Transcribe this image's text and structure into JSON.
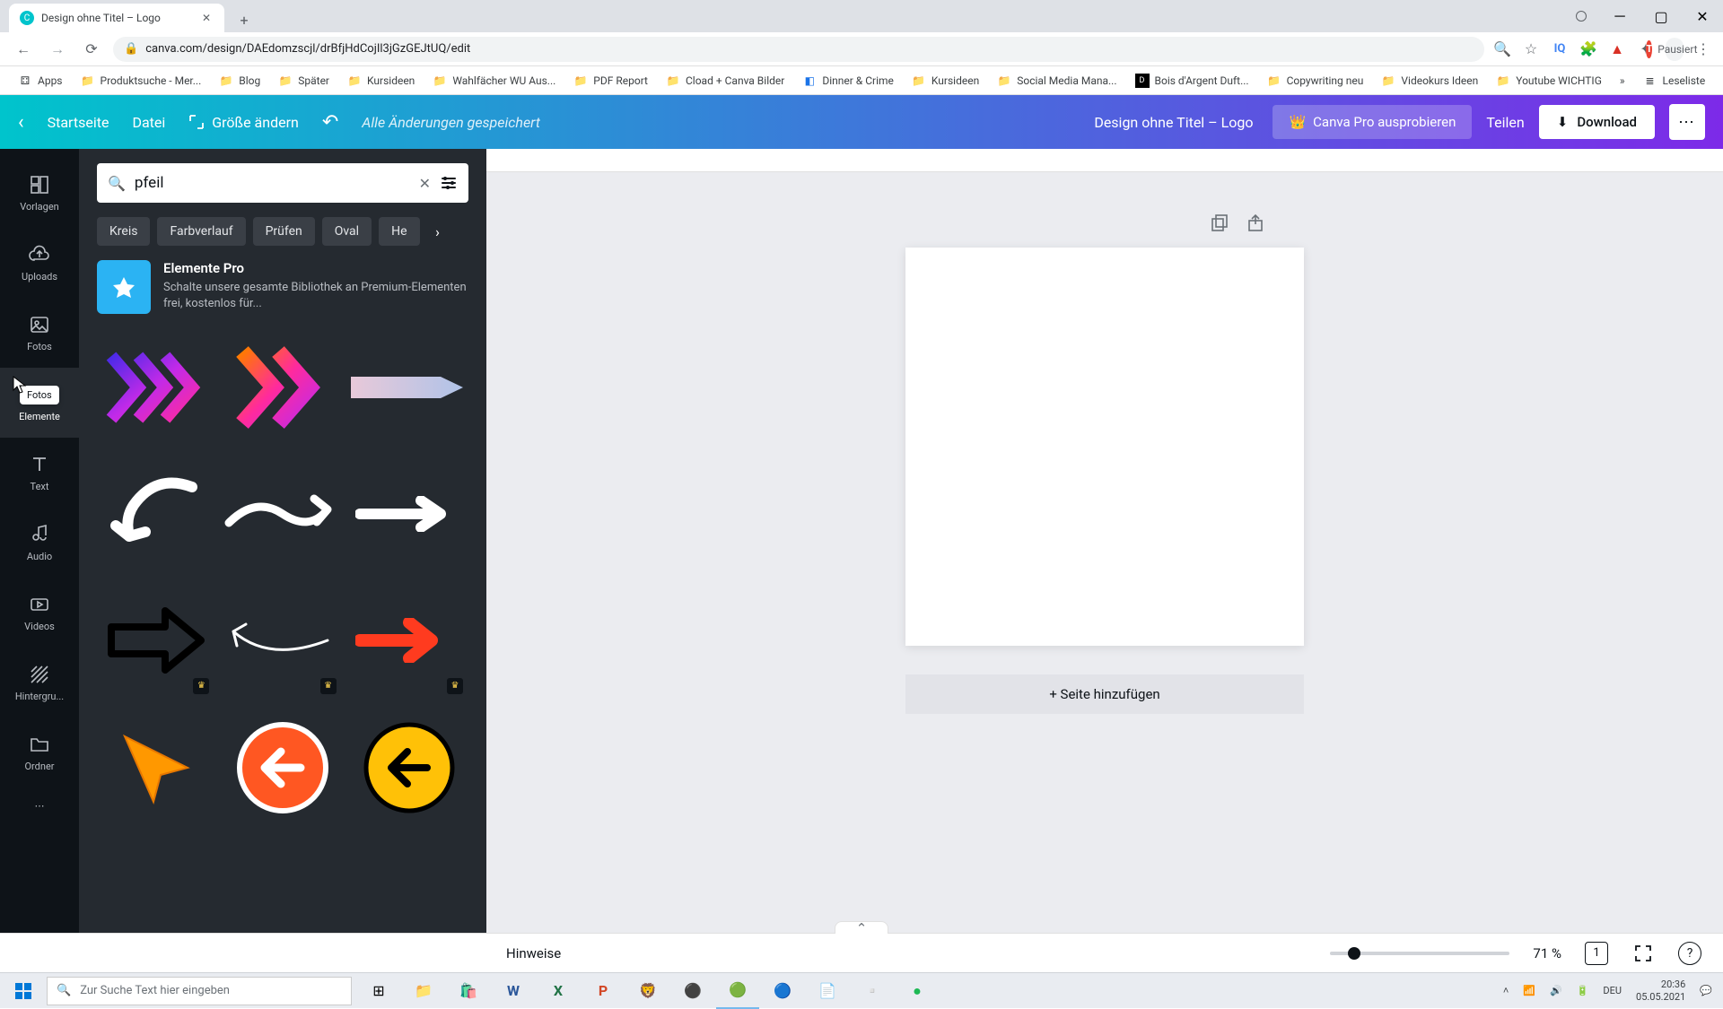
{
  "browser": {
    "tab_title": "Design ohne Titel – Logo",
    "url": "canva.com/design/DAEdomzscjl/drBfjHdCojIl3jGzGEJtUQ/edit",
    "profile_state": "Pausiert",
    "profile_initial": "T",
    "bookmarks": [
      "Apps",
      "Produktsuche - Mer...",
      "Blog",
      "Später",
      "Kursideen",
      "Wahlfächer WU Aus...",
      "PDF Report",
      "Cload + Canva Bilder",
      "Dinner & Crime",
      "Kursideen",
      "Social Media Mana...",
      "Bois d'Argent Duft...",
      "Copywriting neu",
      "Videokurs Ideen",
      "Youtube WICHTIG",
      "Leseliste"
    ]
  },
  "canva_top": {
    "back": "Startseite",
    "file": "Datei",
    "resize": "Größe ändern",
    "saved": "Alle Änderungen gespeichert",
    "doc_title": "Design ohne Titel – Logo",
    "try_pro": "Canva Pro ausprobieren",
    "share": "Teilen",
    "download": "Download"
  },
  "nav": {
    "items": [
      "Vorlagen",
      "Uploads",
      "Fotos",
      "Elemente",
      "Text",
      "Audio",
      "Videos",
      "Hintergru...",
      "Ordner"
    ],
    "tooltip": "Fotos"
  },
  "panel": {
    "search_value": "pfeil",
    "chips": [
      "Kreis",
      "Farbverlauf",
      "Prüfen",
      "Oval",
      "He"
    ],
    "promo_title": "Elemente Pro",
    "promo_desc": "Schalte unsere gesamte Bibliothek an Premium-Elementen frei, kostenlos für..."
  },
  "canvas": {
    "add_page": "+ Seite hinzufügen",
    "notes_label": "Hinweise",
    "zoom_pct": "71 %",
    "page_num": "1"
  },
  "taskbar": {
    "search_placeholder": "Zur Suche Text hier eingeben",
    "lang": "DEU",
    "time": "20:36",
    "date": "05.05.2021"
  }
}
